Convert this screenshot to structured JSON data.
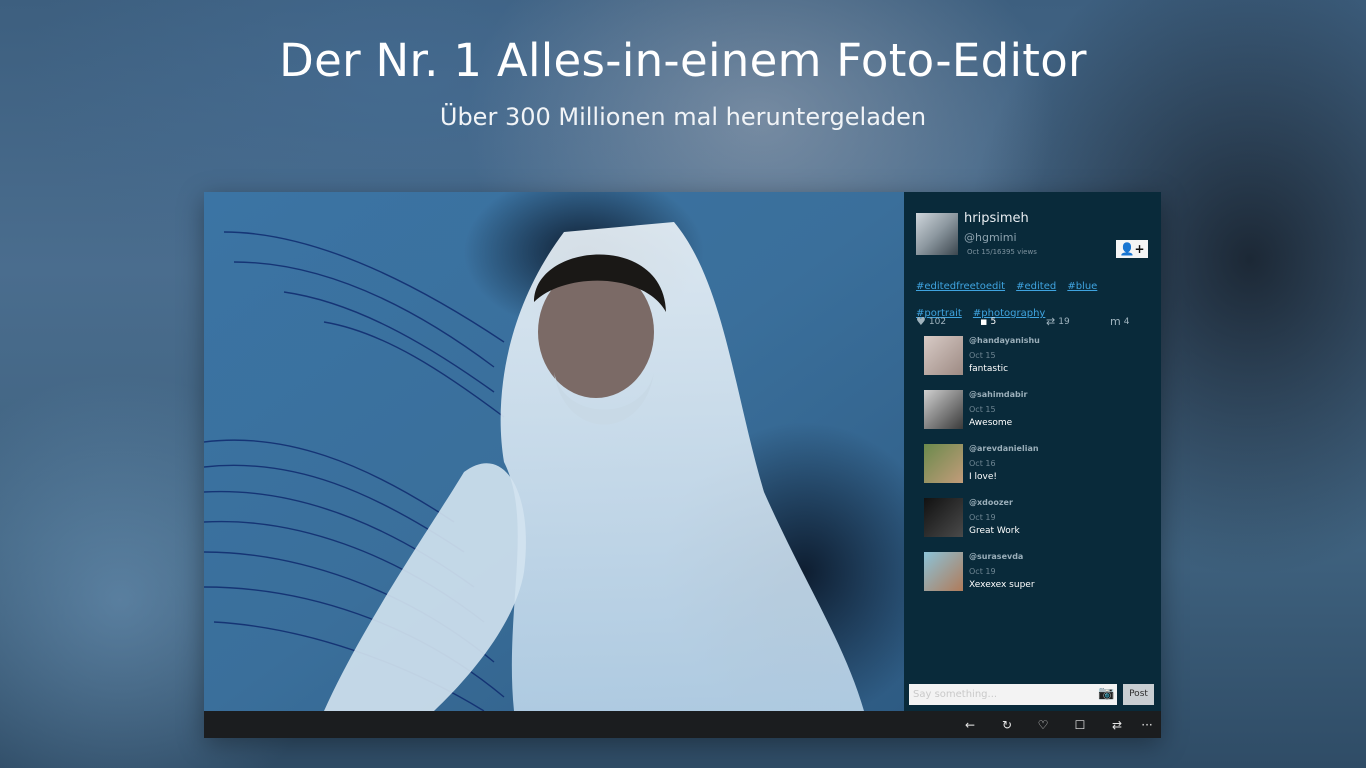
{
  "header": {
    "title": "Der Nr. 1 Alles-in-einem Foto-Editor",
    "subtitle": "Über 300 Millionen mal heruntergeladen"
  },
  "profile": {
    "name": "hripsimeh",
    "handle": "@hgmimi",
    "meta": "Oct 15/16395 views",
    "follow_icon": "add-user-icon",
    "follow_glyph": "👤+"
  },
  "tags": [
    "#editedfreetoedit",
    "#edited",
    "#blue",
    "#portrait",
    "#photography"
  ],
  "stats": {
    "likes": {
      "icon": "heart-icon",
      "glyph": "♥",
      "value": "102"
    },
    "comments": {
      "icon": "comment-icon",
      "glyph": "▪",
      "value": "5"
    },
    "reposts": {
      "icon": "repost-icon",
      "glyph": "⇄",
      "value": "19"
    },
    "memberships": {
      "icon": "m-icon",
      "glyph": "m",
      "value": "4"
    }
  },
  "comments": [
    {
      "user": "@handayanishu",
      "date": "Oct 15",
      "text": "fantastic",
      "avatar_color": "#b9a7a0"
    },
    {
      "user": "@sahimdabir",
      "date": "Oct 15",
      "text": "Awesome",
      "avatar_color": "#6d6d6d"
    },
    {
      "user": "@arevdanielian",
      "date": "Oct 16",
      "text": "I love!",
      "avatar_color": "#8a6a4e"
    },
    {
      "user": "@xdoozer",
      "date": "Oct 19",
      "text": "Great Work",
      "avatar_color": "#1e1e1e"
    },
    {
      "user": "@surasevda",
      "date": "Oct 19",
      "text": "Xexexex super",
      "avatar_color": "#a67e63"
    }
  ],
  "composer": {
    "placeholder": "Say something...",
    "post_label": "Post",
    "camera_icon": "camera-icon",
    "camera_glyph": "📷"
  },
  "appbar": [
    {
      "name": "back-icon",
      "glyph": "←"
    },
    {
      "name": "refresh-icon",
      "glyph": "↻"
    },
    {
      "name": "like-icon",
      "glyph": "♡"
    },
    {
      "name": "comment-icon",
      "glyph": "☐"
    },
    {
      "name": "repost-icon",
      "glyph": "⇄"
    },
    {
      "name": "more-icon",
      "glyph": "···"
    }
  ],
  "colors": {
    "accent_link": "#3fa4e0",
    "panel_bg": "#092a3a",
    "appbar_bg": "#1b1d1f"
  }
}
